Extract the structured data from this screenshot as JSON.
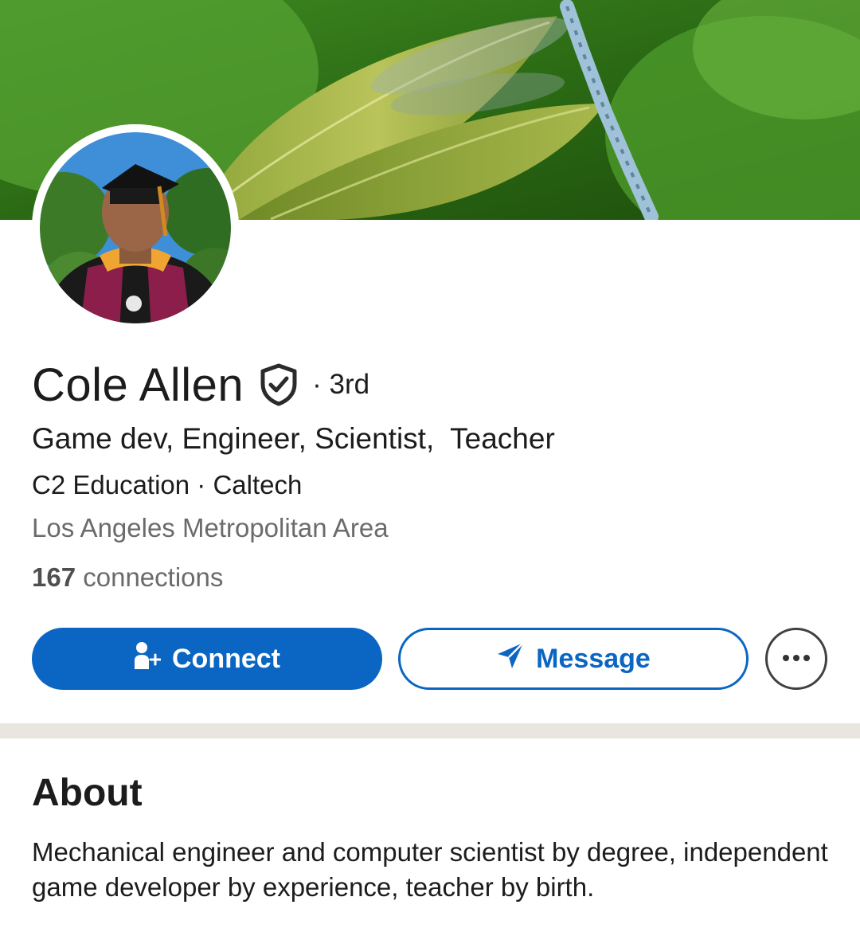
{
  "profile": {
    "name": "Cole Allen",
    "degree": "· 3rd",
    "headline": "Game dev, Engineer, Scientist,  Teacher",
    "organizations": "C2 Education · Caltech",
    "location": "Los Angeles Metropolitan Area",
    "connections_count": "167",
    "connections_label": "connections"
  },
  "actions": {
    "connect_label": "Connect",
    "message_label": "Message",
    "connect_icon": "add-person-icon",
    "message_icon": "paper-plane-icon",
    "more_icon": "more-horizontal-icon"
  },
  "about": {
    "title": "About",
    "text": "Mechanical engineer and computer scientist by degree, independent game developer by experience, teacher by birth."
  },
  "colors": {
    "primary": "#0a66c2",
    "section_divider": "#e9e5df",
    "text_primary": "#1c1c1c",
    "text_secondary": "#6b6b6b"
  }
}
